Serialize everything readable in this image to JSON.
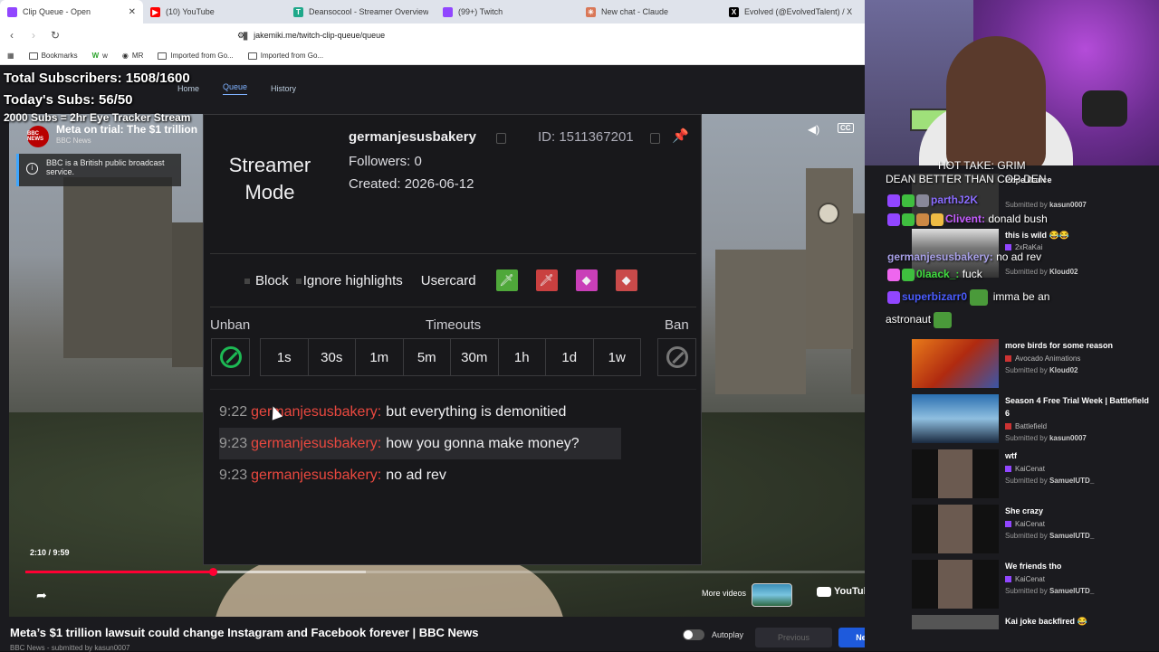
{
  "browser": {
    "tabs": [
      {
        "label": "Clip Queue - Open",
        "icon": "clip-queue-icon",
        "color": "#9146ff",
        "active": true
      },
      {
        "label": "(10) YouTube",
        "icon": "youtube-icon",
        "color": "#ff0000",
        "active": false
      },
      {
        "label": "Deansocool - Streamer Overview",
        "icon": "tt-icon",
        "color": "#1fa88a",
        "active": false
      },
      {
        "label": "(99+) Twitch",
        "icon": "twitch-icon",
        "color": "#9146ff",
        "active": false
      },
      {
        "label": "New chat - Claude",
        "icon": "claude-icon",
        "color": "#d97757",
        "active": false
      },
      {
        "label": "Evolved (@EvolvedTalent) / X",
        "icon": "x-icon",
        "color": "#000000",
        "active": false
      }
    ],
    "url": "jakemiki.me/twitch-clip-queue/queue",
    "bookmarks": [
      "Bookmarks",
      "w",
      "MR",
      "Imported from Go...",
      "Imported from Go..."
    ]
  },
  "app": {
    "nav": [
      "Home",
      "Queue",
      "History"
    ],
    "active_nav": "Queue"
  },
  "stream_overlay": {
    "subs_total": "Total Subscribers: 1508/1600",
    "subs_today": "Today's Subs: 56/50",
    "goal": "2000 Subs = 2hr Eye Tracker Stream"
  },
  "video": {
    "title": "Meta on trial: The $1 trillion",
    "channel": "BBC News",
    "channel_badge": "BBC NEWS",
    "info_notice": "BBC is a British public broadcast service.",
    "time": "2:10 / 9:59",
    "progress": 0.22,
    "more_videos": "More videos",
    "youtube_label": "YouTube"
  },
  "current_clip": {
    "title": "Meta’s $1 trillion lawsuit could change Instagram and Facebook forever | BBC News",
    "meta": "BBC News - submitted by kasun0007",
    "autoplay_label": "Autoplay",
    "prev_label": "Previous",
    "next_label": "Next"
  },
  "usercard": {
    "streamer_mode": "Streamer Mode",
    "username": "germanjesusbakery",
    "id": "ID: 1511367201",
    "followers": "Followers: 0",
    "created": "Created: 2026-06-12",
    "actions": {
      "block": "Block",
      "ignore": "Ignore highlights",
      "usercard": "Usercard"
    },
    "unban_label": "Unban",
    "timeouts_label": "Timeouts",
    "ban_label": "Ban",
    "timeouts": [
      "1s",
      "30s",
      "1m",
      "5m",
      "30m",
      "1h",
      "1d",
      "1w"
    ],
    "messages": [
      {
        "time": "9:22",
        "user": "germanjesusbakery:",
        "text": "but everything is demonitied"
      },
      {
        "time": "9:23",
        "user": "germanjesusbakery:",
        "text": "how you gonna make money?"
      },
      {
        "time": "9:23",
        "user": "germanjesusbakery:",
        "text": "no ad rev"
      }
    ]
  },
  "chat_overlay": [
    {
      "user": "",
      "text": "HOT TAKE: GRIM"
    },
    {
      "user": "",
      "text": "DEAN BETTER THAN COP DEN"
    },
    {
      "user": "parthJ2K",
      "text": ""
    },
    {
      "user": "Clivent:",
      "text": "donald bush"
    },
    {
      "user": "germanjesusbakery:",
      "text": "no ad rev"
    },
    {
      "user": "0laack_:",
      "text": "fuck"
    },
    {
      "user": "superbizarr0",
      "text": "imma be an"
    },
    {
      "user": "",
      "text": "astronaut"
    }
  ],
  "queue": [
    {
      "title": "Pope Dance",
      "channel": "",
      "submitter": "kasun0007"
    },
    {
      "title": "this is wild 😂😂",
      "channel": "2xRaKai",
      "submitter": "Kloud02"
    },
    {
      "title": "more birds for some reason",
      "channel": "Avocado Animations",
      "submitter": "Kloud02"
    },
    {
      "title": "Season 4 Free Trial Week | Battlefield 6",
      "channel": "Battlefield",
      "submitter": "kasun0007"
    },
    {
      "title": "wtf",
      "channel": "KaiCenat",
      "submitter": "SamuelUTD_"
    },
    {
      "title": "She crazy",
      "channel": "KaiCenat",
      "submitter": "SamuelUTD_"
    },
    {
      "title": "We friends tho",
      "channel": "KaiCenat",
      "submitter": "SamuelUTD_"
    },
    {
      "title": "Kai joke backfired 😂",
      "channel": "",
      "submitter": ""
    }
  ],
  "submitted_by_label": "Submitted by",
  "colors": {
    "accent": "#7fb2ff",
    "username_red": "#e9483f",
    "next_blue": "#1e5adc",
    "youtube_red": "#ff0033",
    "twitch_purple": "#9146ff"
  }
}
